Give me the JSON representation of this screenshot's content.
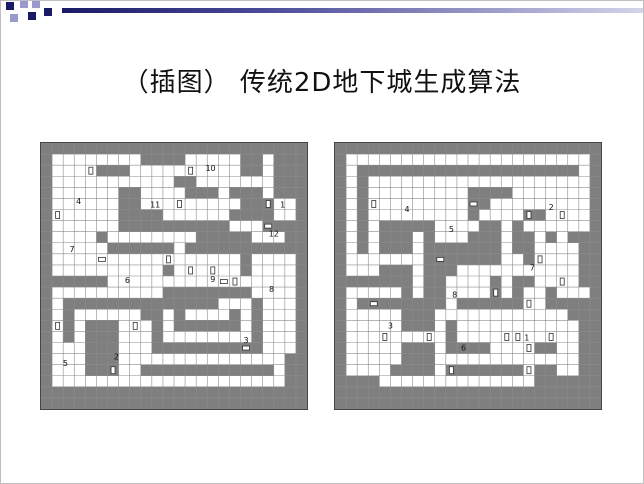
{
  "slide": {
    "title": "（插图） 传统2D地下城生成算法"
  },
  "colors": {
    "wall": "#7f7f7f",
    "floor": "#ffffff",
    "grid": "#9a9a9a",
    "deco_dark": "#1a1a66",
    "deco_light": "#bdbdd9"
  },
  "maps": [
    {
      "name": "dungeon-a",
      "room_labels": [
        "10",
        "4",
        "11",
        "1",
        "12",
        "7",
        "6",
        "9",
        "8",
        "5",
        "2",
        "3"
      ]
    },
    {
      "name": "dungeon-b",
      "room_labels": [
        "4",
        "2",
        "5",
        "7",
        "8",
        "3",
        "6",
        "1"
      ]
    }
  ]
}
